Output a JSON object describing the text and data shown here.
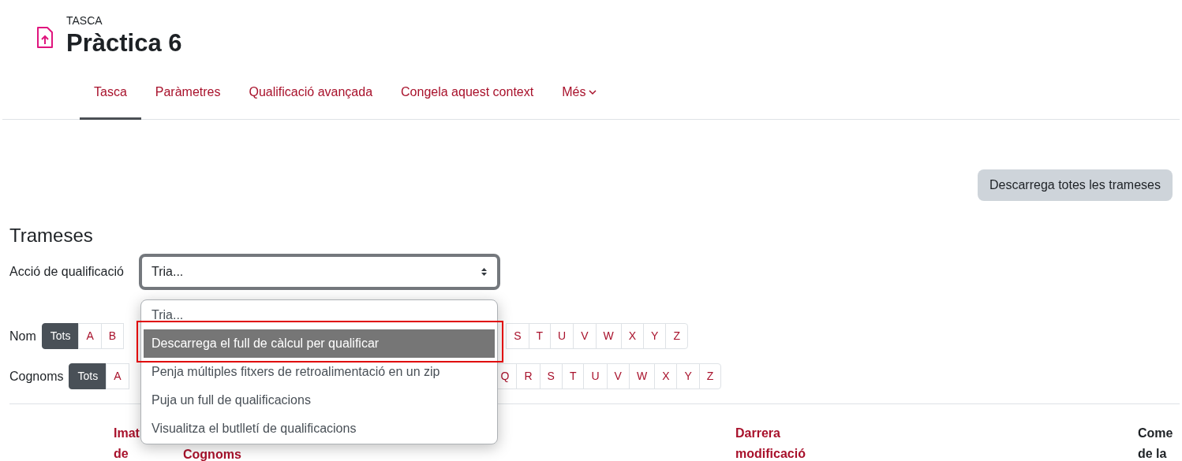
{
  "header": {
    "kicker": "TASCA",
    "title": "Pràctica 6"
  },
  "tabs": [
    {
      "label": "Tasca",
      "selected": true
    },
    {
      "label": "Paràmetres",
      "selected": false
    },
    {
      "label": "Qualificació avançada",
      "selected": false
    },
    {
      "label": "Congela aquest context",
      "selected": false
    },
    {
      "label": "Més",
      "selected": false,
      "kind": "dropdown"
    }
  ],
  "download_button": "Descarrega totes les trameses",
  "section_title": "Trameses",
  "grading_action": {
    "label": "Acció de qualificació",
    "value": "Tria...",
    "options": [
      {
        "label": "Tria...",
        "highlighted": false
      },
      {
        "label": "Descarrega el full de càlcul per qualificar",
        "highlighted": true
      },
      {
        "label": "Penja múltiples fitxers de retroalimentació en un zip",
        "highlighted": false
      },
      {
        "label": "Puja un full de qualificacions",
        "highlighted": false
      },
      {
        "label": "Visualitza el butlletí de qualificacions",
        "highlighted": false
      }
    ]
  },
  "filters": [
    {
      "label": "Nom",
      "before": [
        {
          "label": "Tots",
          "selected": true
        },
        {
          "label": "A",
          "selected": false
        },
        {
          "label": "B",
          "selected": false
        }
      ],
      "after": [
        {
          "label": "S",
          "selected": false
        },
        {
          "label": "T",
          "selected": false
        },
        {
          "label": "U",
          "selected": false
        },
        {
          "label": "V",
          "selected": false
        },
        {
          "label": "W",
          "selected": false
        },
        {
          "label": "X",
          "selected": false
        },
        {
          "label": "Y",
          "selected": false
        },
        {
          "label": "Z",
          "selected": false
        }
      ]
    },
    {
      "label": "Cognoms",
      "before": [
        {
          "label": "Tots",
          "selected": true
        },
        {
          "label": "A",
          "selected": false
        }
      ],
      "after": [
        {
          "label": "Q",
          "selected": false
        },
        {
          "label": "R",
          "selected": false
        },
        {
          "label": "S",
          "selected": false
        },
        {
          "label": "T",
          "selected": false
        },
        {
          "label": "U",
          "selected": false
        },
        {
          "label": "V",
          "selected": false
        },
        {
          "label": "W",
          "selected": false
        },
        {
          "label": "X",
          "selected": false
        },
        {
          "label": "Y",
          "selected": false
        },
        {
          "label": "Z",
          "selected": false
        }
      ]
    }
  ],
  "table": {
    "columns": [
      {
        "label": "Imat de",
        "link": true
      },
      {
        "label": "Cognoms",
        "link": true
      },
      {
        "label": "Darrera modificació",
        "link": true
      },
      {
        "label": "Come de la",
        "link": false
      }
    ]
  }
}
